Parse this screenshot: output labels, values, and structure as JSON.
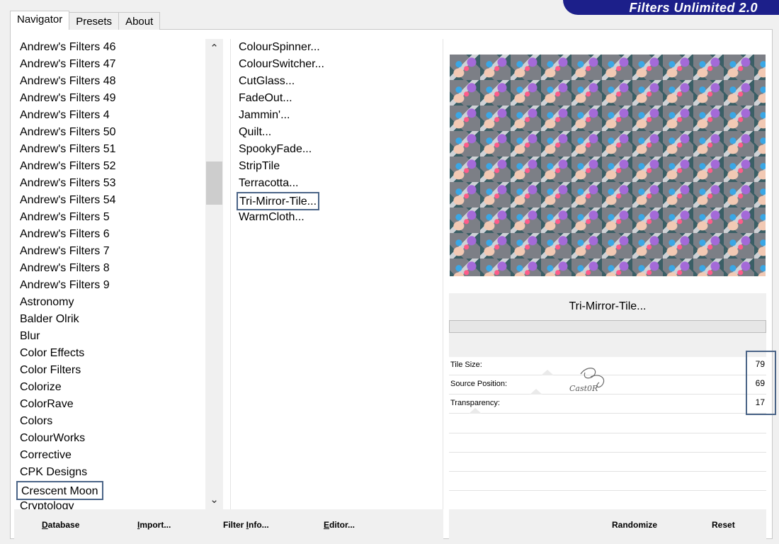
{
  "app": {
    "title": "Filters Unlimited 2.0"
  },
  "tabs": [
    "Navigator",
    "Presets",
    "About"
  ],
  "categories": [
    "Andrew's Filters 46",
    "Andrew's Filters 47",
    "Andrew's Filters 48",
    "Andrew's Filters 49",
    "Andrew's Filters 4",
    "Andrew's Filters 50",
    "Andrew's Filters 51",
    "Andrew's Filters 52",
    "Andrew's Filters 53",
    "Andrew's Filters 54",
    "Andrew's Filters 5",
    "Andrew's Filters 6",
    "Andrew's Filters 7",
    "Andrew's Filters 8",
    "Andrew's Filters 9",
    "Astronomy",
    "Balder Olrik",
    "Blur",
    "Color Effects",
    "Color Filters",
    "Colorize",
    "ColorRave",
    "Colors",
    "ColourWorks",
    "Corrective",
    "CPK Designs",
    "Crescent Moon",
    "Cryptology"
  ],
  "selected_category": "Crescent Moon",
  "filters": [
    "ColourSpinner...",
    "ColourSwitcher...",
    "CutGlass...",
    "FadeOut...",
    "Jammin'...",
    "Quilt...",
    "SpookyFade...",
    "StripTile",
    "Terracotta...",
    "Tri-Mirror-Tile...",
    "WarmCloth..."
  ],
  "selected_filter": "Tri-Mirror-Tile...",
  "current_filter_name": "Tri-Mirror-Tile...",
  "params": [
    {
      "label": "Tile Size:",
      "value": "79"
    },
    {
      "label": "Source Position:",
      "value": "69"
    },
    {
      "label": "Transparency:",
      "value": "17"
    }
  ],
  "param_levels": [
    79,
    69,
    17
  ],
  "buttons": {
    "database": {
      "prefix": "",
      "underline": "D",
      "rest": "atabase"
    },
    "import": {
      "prefix": "",
      "underline": "I",
      "rest": "mport..."
    },
    "filter_info": {
      "prefix": "Filter ",
      "underline": "I",
      "rest": "nfo..."
    },
    "editor": {
      "prefix": "",
      "underline": "E",
      "rest": "ditor..."
    },
    "randomize": "Randomize",
    "reset": "Reset"
  },
  "watermark_text": "Cast0R",
  "colors": {
    "banner": "#1c1f8a",
    "selection_border": "#4a6487"
  }
}
